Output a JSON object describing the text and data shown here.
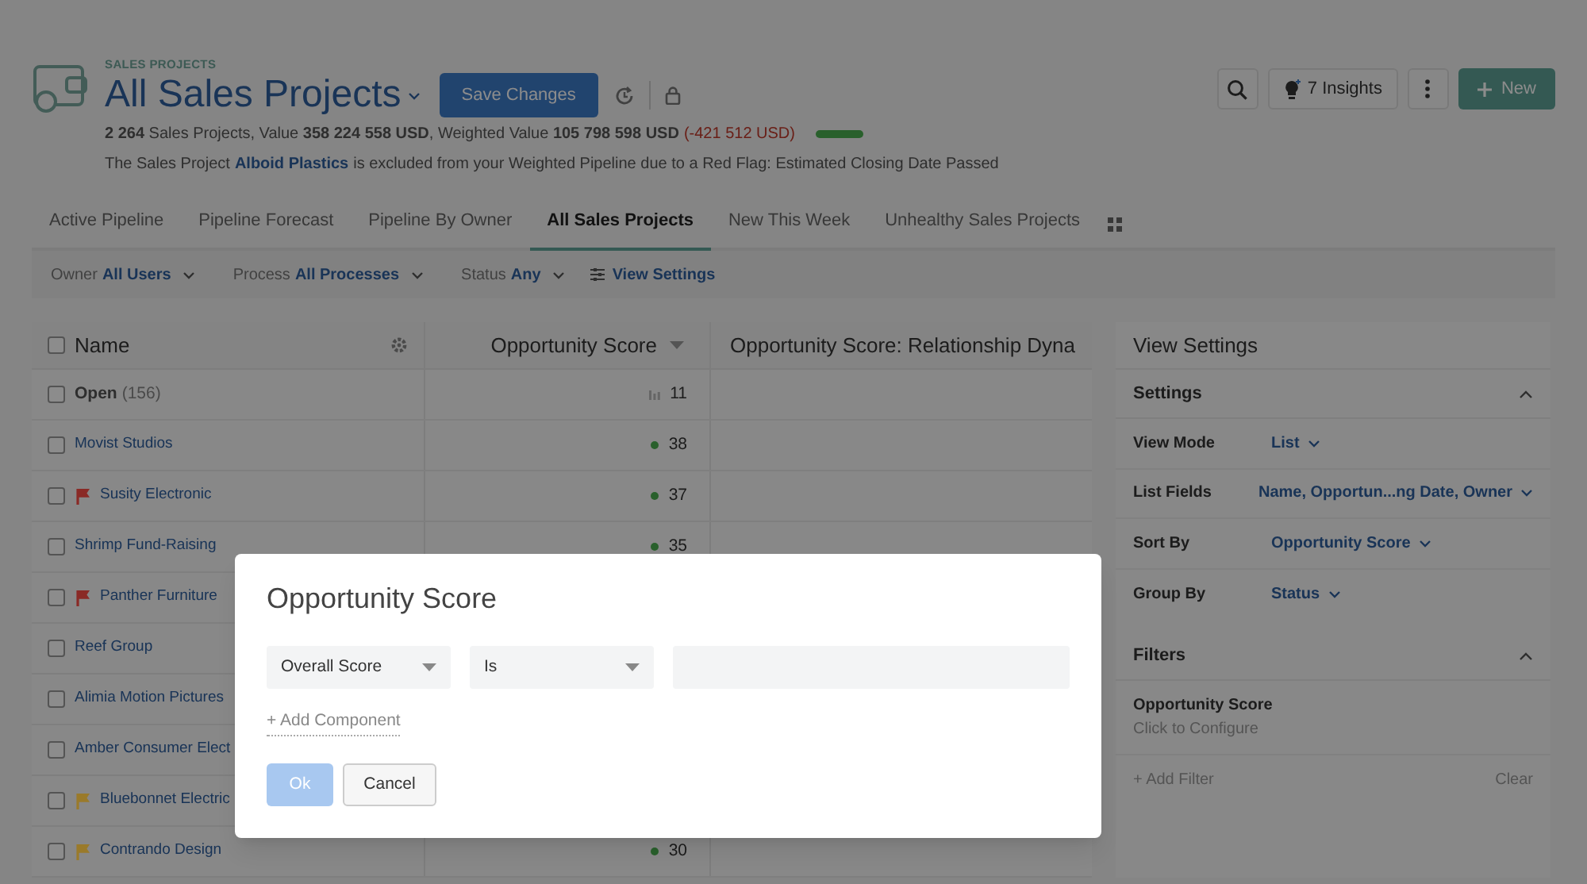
{
  "header": {
    "section_label": "SALES PROJECTS",
    "title": "All Sales Projects",
    "save_button": "Save Changes",
    "summary": "**2 264** Sales Projects, Value **358 224 558 USD**, Weighted Value **105 798 598 USD**",
    "weighted_change": "(-421 512 USD)",
    "notice_before": "The Sales Project",
    "notice_link": "Alboid Plastics",
    "notice_after": "is excluded from your Weighted Pipeline due to a Red Flag: Estimated Closing Date Passed"
  },
  "toolbar": {
    "insights_button": "7 Insights",
    "new_button": "New"
  },
  "tabs": [
    {
      "label": "Active Pipeline",
      "selected": false
    },
    {
      "label": "Pipeline Forecast",
      "selected": false
    },
    {
      "label": "Pipeline By Owner",
      "selected": false
    },
    {
      "label": "All Sales Projects",
      "selected": true
    },
    {
      "label": "New This Week",
      "selected": false
    },
    {
      "label": "Unhealthy Sales Projects",
      "selected": false
    }
  ],
  "filters": [
    {
      "label": "Owner",
      "value": "All Users"
    },
    {
      "label": "Process",
      "value": "All Processes"
    },
    {
      "label": "Status",
      "value": "Any"
    }
  ],
  "view_settings_link": "View Settings",
  "table": {
    "select_all_checked": false,
    "columns": [
      "Name",
      "Opportunity Score",
      "Opportunity Score: Relationship Dyna"
    ],
    "rows": [
      {
        "kind": "group",
        "name": "Open",
        "count": "(156)",
        "score": "11",
        "checked": false
      },
      {
        "kind": "item",
        "name": "Movist Studios",
        "score": "38",
        "checked": false
      },
      {
        "kind": "item",
        "name": "Susity Electronic",
        "color": "#8a2a26",
        "score": "37",
        "checked": false
      },
      {
        "kind": "item",
        "name": "Shrimp Fund-Raising",
        "score": "35",
        "checked": false
      },
      {
        "kind": "item",
        "name": "Panther Furniture",
        "color": "#8a2a26",
        "checked": false
      },
      {
        "kind": "item",
        "name": "Reef Group",
        "checked": false
      },
      {
        "kind": "item",
        "name": "Alimia Motion Pictures",
        "checked": false
      },
      {
        "kind": "item",
        "name": "Amber Consumer Elect",
        "checked": false
      },
      {
        "kind": "item",
        "name": "Bluebonnet Electric",
        "color": "#9a7a2a",
        "checked": false
      },
      {
        "kind": "item",
        "name": "Contrando Design",
        "color": "#9a7a2a",
        "score": "30",
        "checked": false
      }
    ]
  },
  "view_settings": {
    "title": "View Settings",
    "settings": {
      "title": "Settings",
      "expanded": true,
      "rows": [
        {
          "label": "View Mode",
          "value": "List"
        },
        {
          "label": "List Fields",
          "value": "Name, Opportun...ng Date, Owner"
        },
        {
          "label": "Sort By",
          "value": "Opportunity Score"
        },
        {
          "label": "Group By",
          "value": "Status"
        }
      ]
    },
    "filters": {
      "title": "Filters",
      "expanded": true,
      "items": [
        {
          "name": "Opportunity Score",
          "hint": "Click to Configure"
        }
      ],
      "add_filter": "+ Add Filter",
      "clear": "Clear"
    }
  },
  "modal": {
    "title": "Opportunity Score",
    "selects": [
      "Overall Score",
      "Is"
    ],
    "add_component": "+ Add Component",
    "ok_button": {
      "label": "Ok",
      "disabled": true
    },
    "cancel_button": "Cancel"
  }
}
